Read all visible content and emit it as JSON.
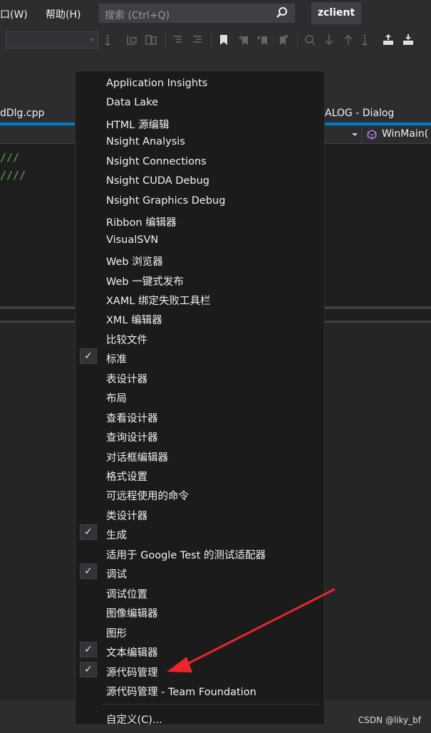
{
  "menubar": {
    "window_menu": "口(W)",
    "help_menu": "帮助(H)",
    "search_placeholder": "搜索 (Ctrl+Q)",
    "solution_name": "zclient"
  },
  "document": {
    "left_tab": "dDlg.cpp",
    "right_tab": "ALOG - Dialog",
    "function_nav": "WinMain(",
    "code_lines": [
      "///",
      "////"
    ]
  },
  "context_menu": {
    "items": [
      {
        "label": "Application Insights",
        "checked": false
      },
      {
        "label": "Data Lake",
        "checked": false
      },
      {
        "label": "HTML 源编辑",
        "checked": false
      },
      {
        "label": "Nsight Analysis",
        "checked": false
      },
      {
        "label": "Nsight Connections",
        "checked": false
      },
      {
        "label": "Nsight CUDA Debug",
        "checked": false
      },
      {
        "label": "Nsight Graphics Debug",
        "checked": false
      },
      {
        "label": "Ribbon 编辑器",
        "checked": false
      },
      {
        "label": "VisualSVN",
        "checked": false
      },
      {
        "label": "Web 浏览器",
        "checked": false
      },
      {
        "label": "Web 一键式发布",
        "checked": false
      },
      {
        "label": "XAML 绑定失败工具栏",
        "checked": false
      },
      {
        "label": "XML 编辑器",
        "checked": false
      },
      {
        "label": "比较文件",
        "checked": false
      },
      {
        "label": "标准",
        "checked": true
      },
      {
        "label": "表设计器",
        "checked": false
      },
      {
        "label": "布局",
        "checked": false
      },
      {
        "label": "查看设计器",
        "checked": false
      },
      {
        "label": "查询设计器",
        "checked": false
      },
      {
        "label": "对话框编辑器",
        "checked": false
      },
      {
        "label": "格式设置",
        "checked": false
      },
      {
        "label": "可远程使用的命令",
        "checked": false
      },
      {
        "label": "类设计器",
        "checked": false
      },
      {
        "label": "生成",
        "checked": true
      },
      {
        "label": "适用于 Google Test 的测试适配器",
        "checked": false
      },
      {
        "label": "调试",
        "checked": true
      },
      {
        "label": "调试位置",
        "checked": false
      },
      {
        "label": "图像编辑器",
        "checked": false
      },
      {
        "label": "图形",
        "checked": false
      },
      {
        "label": "文本编辑器",
        "checked": true
      },
      {
        "label": "源代码管理",
        "checked": true
      },
      {
        "label": "源代码管理 - Team Foundation",
        "checked": false
      }
    ],
    "customize": "自定义(C)...",
    "check_glyph": "✓"
  },
  "watermark": "CSDN @liky_bf",
  "colors": {
    "annotation_arrow": "#e8262b",
    "accent": "#007acc",
    "comment_green": "#57a64a",
    "function_icon": "#b180d7"
  }
}
